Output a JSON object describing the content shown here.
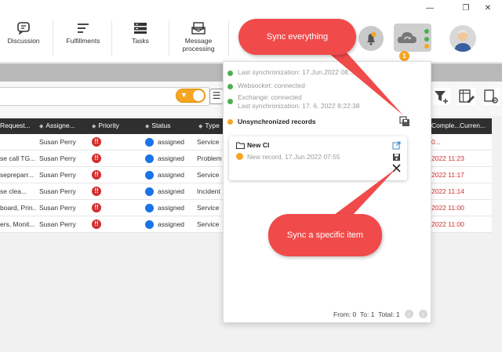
{
  "window": {
    "minimize": "—",
    "maximize": "❐",
    "close": "✕"
  },
  "toolbar": {
    "items": [
      {
        "label": "Discussion",
        "icon": "chat-icon"
      },
      {
        "label": "Fulfillments",
        "icon": "list-icon"
      },
      {
        "label": "Tasks",
        "icon": "tasks-icon"
      },
      {
        "label": "Message processing",
        "icon": "message-processing-icon"
      }
    ]
  },
  "header_icons": {
    "sync_badge": "1"
  },
  "table": {
    "columns": [
      "Request...",
      "Assigne...",
      "Priority",
      "Status",
      "Type",
      "Comple...",
      "Curren..."
    ],
    "rows": [
      {
        "request": "",
        "assignee": "Susan Perry",
        "status": "assigned",
        "type": "Service",
        "date": "0..."
      },
      {
        "request": "se call TG...",
        "assignee": "Susan Perry",
        "status": "assigned",
        "type": "Problem",
        "date": "2022 11:23"
      },
      {
        "request": "sepreparr...",
        "assignee": "Susan Perry",
        "status": "assigned",
        "type": "Service",
        "date": "2022 11:17"
      },
      {
        "request": "se clea...",
        "assignee": "Susan Perry",
        "status": "assigned",
        "type": "Incident",
        "date": "2022 11:14"
      },
      {
        "request": "board, Prin...",
        "assignee": "Susan Perry",
        "status": "assigned",
        "type": "Service",
        "date": "2022 11:00"
      },
      {
        "request": "ers, Monit...",
        "assignee": "Susan Perry",
        "status": "assigned",
        "type": "Service",
        "date": "2022 11:00"
      }
    ],
    "priority_glyph": "!!"
  },
  "sync_panel": {
    "last_sync": "Last synchronization: 17.Jun.2022 08...",
    "websocket": "Websocket: connected",
    "exchange": "Exchange: connected",
    "exchange_last_sync": "Last synchronization: 17. 6. 2022 8:22:38",
    "unsynchronized": "Unsynchronized records",
    "record": {
      "title": "New CI",
      "subtitle": "New record, 17.Jun.2022 07:55"
    },
    "pager": {
      "from": "From: 0",
      "to": "To: 1",
      "total": "Total: 1"
    }
  },
  "callouts": {
    "sync_everything": "Sync everything",
    "sync_item": "Sync a specific item"
  },
  "colors": {
    "accent": "#f5a623",
    "callout": "#f04a4a",
    "status_blue": "#1a73e8",
    "priority_red": "#d32f2f",
    "led_green": "#4caf50"
  }
}
